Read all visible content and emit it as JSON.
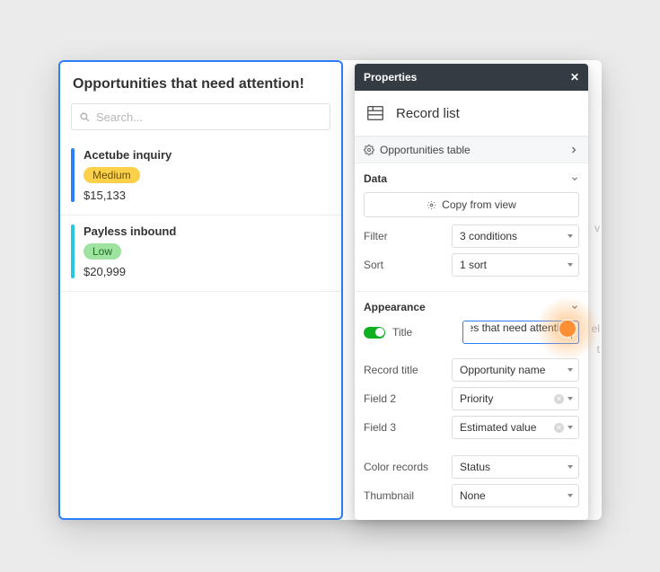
{
  "left": {
    "title": "Opportunities that need attention!",
    "search_placeholder": "Search...",
    "items": [
      {
        "title": "Acetube inquiry",
        "badge_label": "Medium",
        "badge_bg": "#fdd04a",
        "badge_fg": "#6b4f00",
        "bar_color": "#2d7ff9",
        "value": "$15,133"
      },
      {
        "title": "Payless inbound",
        "badge_label": "Low",
        "badge_bg": "#9fe3a1",
        "badge_fg": "#1d6b20",
        "bar_color": "#29c7e0",
        "value": "$20,999"
      }
    ]
  },
  "panel": {
    "header": "Properties",
    "type_label": "Record list",
    "source_label": "Opportunities table",
    "sections": {
      "data": {
        "label": "Data",
        "copy_label": "Copy from view",
        "rows": [
          {
            "label": "Filter",
            "value": "3 conditions"
          },
          {
            "label": "Sort",
            "value": "1 sort"
          }
        ]
      },
      "appearance": {
        "label": "Appearance",
        "title_toggle_label": "Title",
        "title_input_visible": "inities that need attention!",
        "title_input_full": "Opportunities that need attention!",
        "rows1": [
          {
            "label": "Record title",
            "value": "Opportunity name",
            "clearable": false
          },
          {
            "label": "Field 2",
            "value": "Priority",
            "clearable": true
          },
          {
            "label": "Field 3",
            "value": "Estimated value",
            "clearable": true
          }
        ],
        "rows2": [
          {
            "label": "Color records",
            "value": "Status",
            "clearable": false
          },
          {
            "label": "Thumbnail",
            "value": "None",
            "clearable": false
          }
        ]
      }
    }
  }
}
